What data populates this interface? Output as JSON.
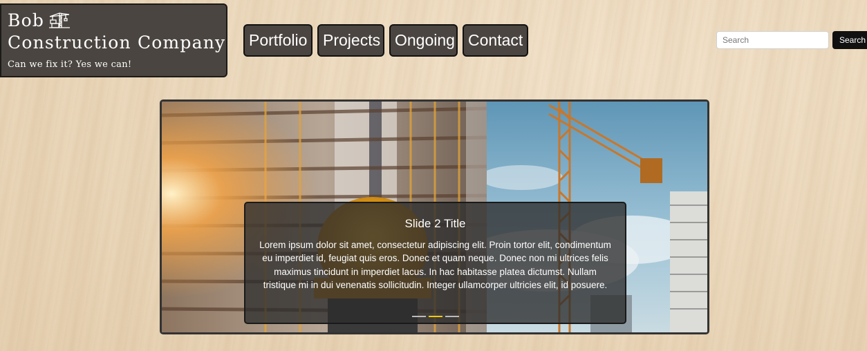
{
  "brand": {
    "title_line1": "Bob",
    "title_line2": "Construction Company",
    "tagline": "Can we fix it? Yes we can!",
    "icon": "crane-icon"
  },
  "nav": {
    "items": [
      {
        "label": "Portfolio"
      },
      {
        "label": "Projects"
      },
      {
        "label": "Ongoing"
      },
      {
        "label": "Contact"
      }
    ]
  },
  "search": {
    "placeholder": "Search",
    "button_label": "Search"
  },
  "carousel": {
    "slide_title": "Slide 2 Title",
    "slide_text": "Lorem ipsum dolor sit amet, consectetur adipiscing elit. Proin tortor elit, condimentum eu imperdiet id, feugiat quis eros. Donec et quam neque. Donec non mi ultrices felis maximus tincidunt in imperdiet lacus. In hac habitasse platea dictumst. Nullam tristique mi in dui venenatis sollicitudin. Integer ullamcorper ultricies elit, id posuere.",
    "slide_count": 3,
    "active_index": 1
  },
  "colors": {
    "panel": "#4a4540",
    "accent_indicator": "#f2c811"
  }
}
